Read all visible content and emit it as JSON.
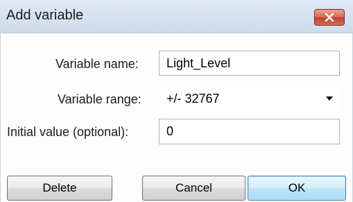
{
  "window": {
    "title": "Add variable",
    "close_icon": "close-x-icon"
  },
  "form": {
    "variable_name": {
      "label": "Variable name:",
      "value": "Light_Level"
    },
    "variable_range": {
      "label": "Variable range:",
      "value": "+/- 32767"
    },
    "initial_value": {
      "label": "Initial value (optional):",
      "value": "0"
    }
  },
  "buttons": {
    "delete": "Delete",
    "cancel": "Cancel",
    "ok": "OK"
  },
  "colors": {
    "close_button": "#c94a36",
    "default_button": "#bee4f8"
  }
}
